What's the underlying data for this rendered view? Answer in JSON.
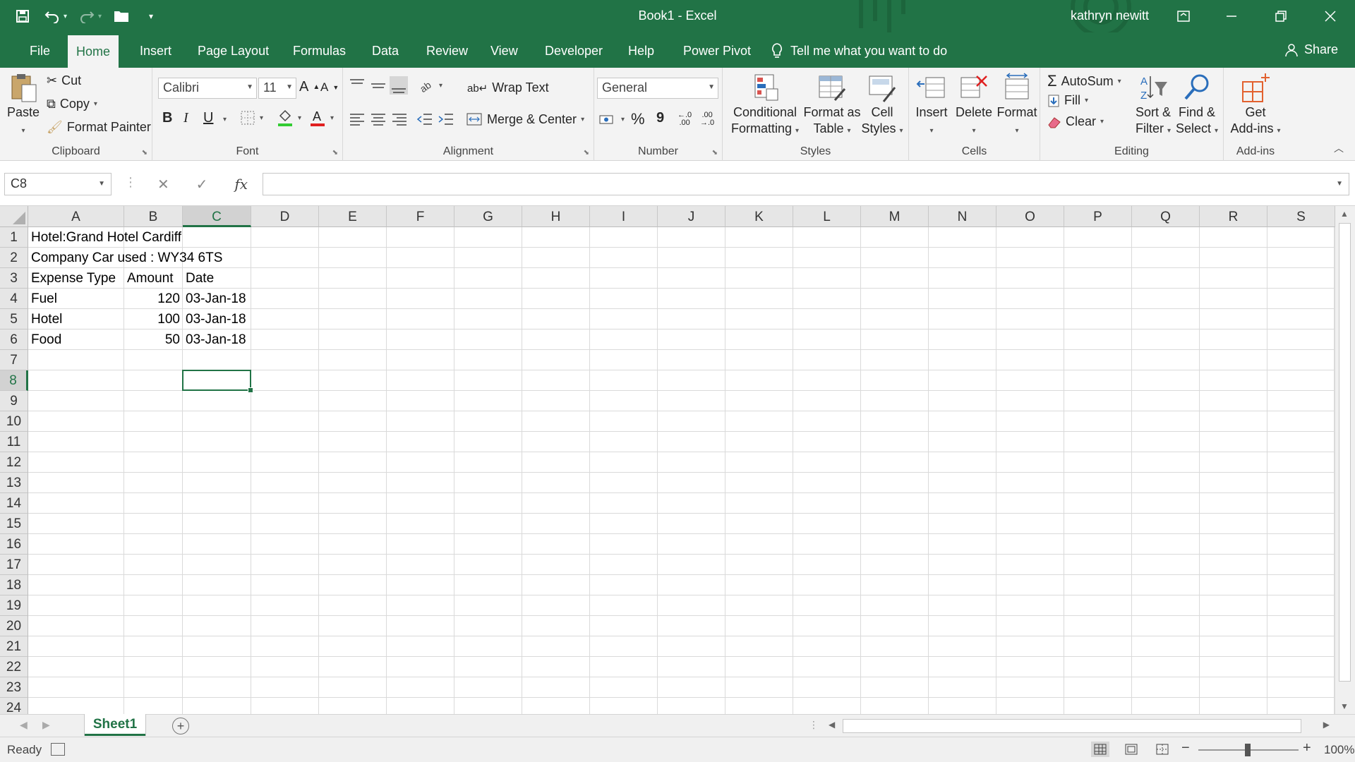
{
  "window": {
    "title": "Book1  -  Excel",
    "user": "kathryn newitt",
    "accent": "#217346"
  },
  "quick_access": {
    "icons": [
      "save-icon",
      "undo-icon",
      "redo-icon",
      "open-icon",
      "customize-icon"
    ]
  },
  "tabs": [
    "File",
    "Home",
    "Insert",
    "Page Layout",
    "Formulas",
    "Data",
    "Review",
    "View",
    "Developer",
    "Help",
    "Power Pivot"
  ],
  "active_tab": "Home",
  "tell_me": "Tell me what you want to do",
  "share": "Share",
  "ribbon": {
    "clipboard": {
      "label": "Clipboard",
      "paste": "Paste",
      "cut": "Cut",
      "copy": "Copy",
      "format_painter": "Format Painter"
    },
    "font": {
      "label": "Font",
      "font_name": "Calibri",
      "font_size": "11",
      "bold": "B",
      "italic": "I",
      "underline": "U"
    },
    "alignment": {
      "label": "Alignment",
      "wrap_text": "Wrap Text",
      "merge_center": "Merge & Center"
    },
    "number": {
      "label": "Number",
      "format": "General",
      "percent": "%",
      "comma": "9"
    },
    "styles": {
      "label": "Styles",
      "conditional_1": "Conditional",
      "conditional_2": "Formatting",
      "format_table_1": "Format as",
      "format_table_2": "Table",
      "cell_styles_1": "Cell",
      "cell_styles_2": "Styles"
    },
    "cells": {
      "label": "Cells",
      "insert": "Insert",
      "delete": "Delete",
      "format": "Format"
    },
    "editing": {
      "label": "Editing",
      "autosum": "AutoSum",
      "fill": "Fill",
      "clear": "Clear",
      "sort_1": "Sort &",
      "sort_2": "Filter",
      "find_1": "Find &",
      "find_2": "Select"
    },
    "addins": {
      "label": "Add-ins",
      "get_1": "Get",
      "get_2": "Add-ins"
    }
  },
  "formula_bar": {
    "name_box": "C8",
    "formula": "",
    "fx": "fx"
  },
  "sheet": {
    "columns": [
      "A",
      "B",
      "C",
      "D",
      "E",
      "F",
      "G",
      "H",
      "I",
      "J",
      "K",
      "L",
      "M",
      "N",
      "O",
      "P",
      "Q",
      "R",
      "S"
    ],
    "rows": [
      "1",
      "2",
      "3",
      "4",
      "5",
      "6",
      "7",
      "8",
      "9",
      "10",
      "11",
      "12",
      "13",
      "14",
      "15",
      "16",
      "17",
      "18",
      "19",
      "20",
      "21",
      "22",
      "23",
      "24"
    ],
    "selected_column": "C",
    "selected_row": "8",
    "cells": {
      "A1": "Hotel:Grand Hotel Cardiff",
      "A2": "Company Car used : WY34 6TS",
      "A3": "Expense Type",
      "B3": "Amount",
      "C3": "Date",
      "A4": "Fuel",
      "B4": "120",
      "C4": "03-Jan-18",
      "A5": "Hotel",
      "B5": "100",
      "C5": "03-Jan-18",
      "A6": "Food",
      "B6": "50",
      "C6": "03-Jan-18"
    }
  },
  "sheet_tabs": [
    "Sheet1"
  ],
  "status": {
    "ready": "Ready",
    "zoom": "100%"
  }
}
